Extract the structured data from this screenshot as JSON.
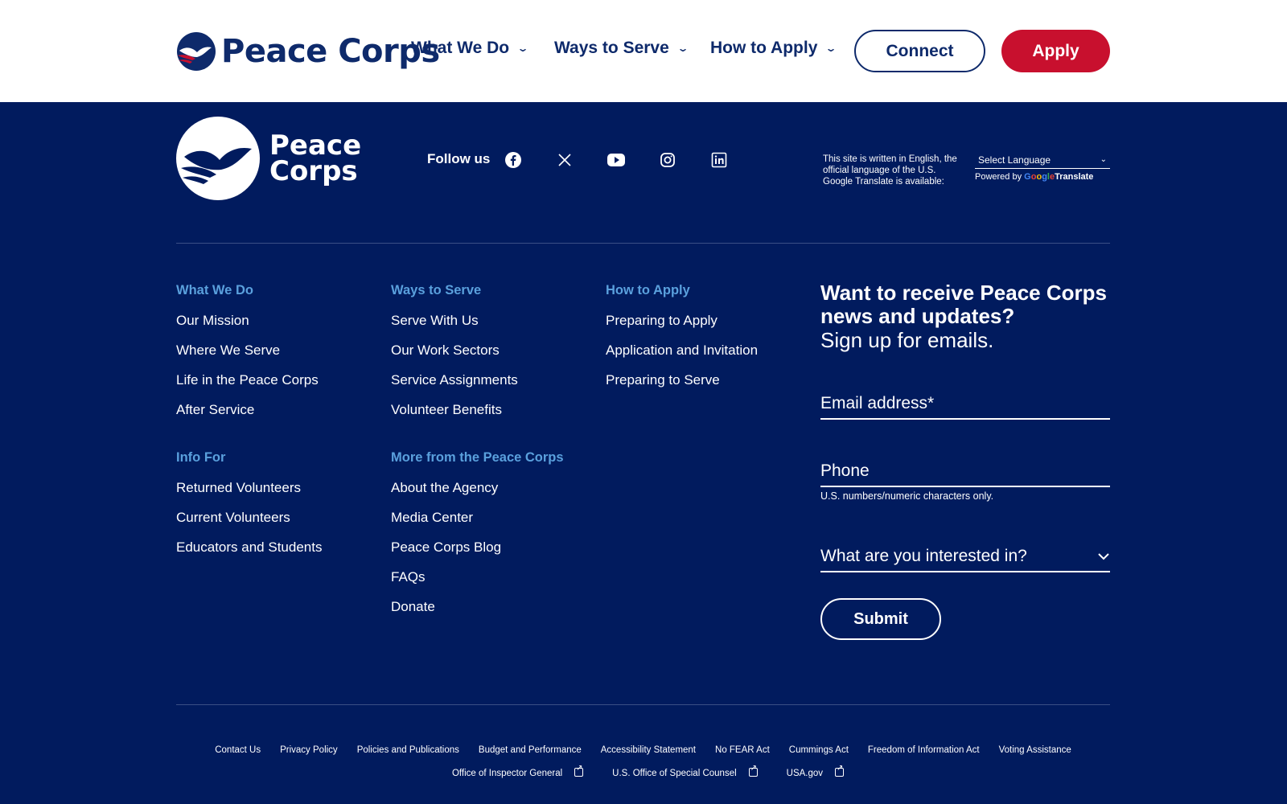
{
  "header": {
    "logo_text": "Peace Corps",
    "nav": [
      {
        "label": "What We Do"
      },
      {
        "label": "Ways to Serve"
      },
      {
        "label": "How to Apply"
      }
    ],
    "connect_label": "Connect",
    "apply_label": "Apply"
  },
  "footer_top": {
    "logo_line1": "Peace",
    "logo_line2": "Corps",
    "follow_label": "Follow us",
    "social": [
      "facebook-icon",
      "x-icon",
      "youtube-icon",
      "instagram-icon",
      "linkedin-icon"
    ],
    "language_note": "This site is written in English, the official language of the U.S. Google Translate is available:",
    "language_select": "Select Language",
    "powered_by": "Powered by",
    "translate": "Translate"
  },
  "columns": [
    {
      "heading": "What We Do",
      "links": [
        "Our Mission",
        "Where We Serve",
        "Life in the Peace Corps",
        "After Service"
      ]
    },
    {
      "heading": "Ways to Serve",
      "links": [
        "Serve With Us",
        "Our Work Sectors",
        "Service Assignments",
        "Volunteer Benefits"
      ]
    },
    {
      "heading": "How to Apply",
      "links": [
        "Preparing to Apply",
        "Application and Invitation",
        "Preparing to Serve"
      ]
    },
    {
      "heading": "Info For",
      "links": [
        "Returned Volunteers",
        "Current Volunteers",
        "Educators and Students"
      ]
    },
    {
      "heading": "More from the Peace Corps",
      "links": [
        "About the Agency",
        "Media Center",
        "Peace Corps Blog",
        "FAQs",
        "Donate"
      ]
    }
  ],
  "signup": {
    "title": "Want to receive Peace Corps news and updates?",
    "subtitle": "Sign up for emails.",
    "email_placeholder": "Email address*",
    "phone_placeholder": "Phone",
    "phone_help": "U.S. numbers/numeric characters only.",
    "interest_placeholder": "What are you interested in?",
    "submit_label": "Submit"
  },
  "bottom_links_row1": [
    "Contact Us",
    "Privacy Policy",
    "Policies and Publications",
    "Budget and Performance",
    "Accessibility Statement",
    "No FEAR Act",
    "Cummings Act",
    "Freedom of Information Act",
    "Voting Assistance"
  ],
  "bottom_links_row2": [
    "Office of Inspector General",
    "U.S. Office of Special Counsel",
    "USA.gov"
  ],
  "colors": {
    "navy": "#011b5e",
    "brand_blue": "#0e2a6b",
    "apply_red": "#c8102e",
    "heading_blue": "#5aa0dd"
  }
}
